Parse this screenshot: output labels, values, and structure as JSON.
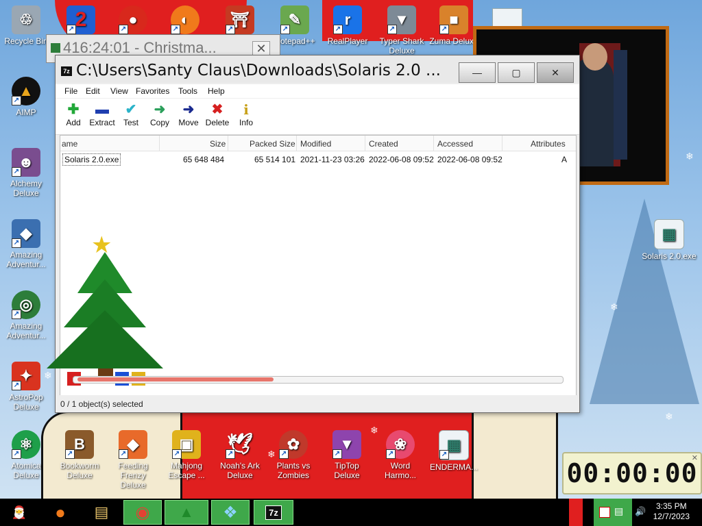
{
  "desktop": {
    "icons_left": [
      {
        "label": "Recycle Bin",
        "icon": "recycle-bin-icon",
        "color": "#9aa7b3"
      },
      {
        "label": "AIMP",
        "icon": "aimp-icon",
        "color": "#e9a51c"
      },
      {
        "label": "Alchemy Deluxe",
        "icon": "alchemy-wizard-icon",
        "color": "#7a4d8f"
      },
      {
        "label": "Amazing Adventur...",
        "icon": "amazing-adventures-icon",
        "color": "#3b6fb0"
      },
      {
        "label": "Amazing Adventur...",
        "icon": "amazing-adventures-globe-icon",
        "color": "#2d7d3a"
      },
      {
        "label": "AstroPop Deluxe",
        "icon": "astropop-icon",
        "color": "#d9331f"
      }
    ],
    "icons_top": [
      {
        "label": "",
        "icon": "number-2-icon",
        "color": "#1f5fd1"
      },
      {
        "label": "",
        "icon": "red-creature-icon",
        "color": "#d8281c"
      },
      {
        "label": "",
        "icon": "firefox-icon",
        "color": "#f07a1b"
      },
      {
        "label": "",
        "icon": "torii-gate-icon",
        "color": "#c53a22"
      },
      {
        "label": "Notepad++",
        "icon": "notepad-plus-plus-icon",
        "color": "#6aa84f"
      },
      {
        "label": "RealPlayer",
        "icon": "realplayer-icon",
        "color": "#1a73e8"
      },
      {
        "label": "Typer Shark Deluxe",
        "icon": "typer-shark-icon",
        "color": "#7d8a96"
      },
      {
        "label": "Zuma Deluxe",
        "icon": "zuma-icon",
        "color": "#d9822b"
      }
    ],
    "icons_bottom": [
      {
        "label": "Atomica Deluxe",
        "icon": "atomica-icon",
        "color": "#1e9f4a"
      },
      {
        "label": "Bookworm Deluxe",
        "icon": "bookworm-icon",
        "color": "#8a5a2b"
      },
      {
        "label": "Feeding Frenzy Deluxe",
        "icon": "feeding-frenzy-icon",
        "color": "#e86a2a"
      },
      {
        "label": "Mahjong Escape ...",
        "icon": "mahjong-icon",
        "color": "#e0b21c"
      },
      {
        "label": "Noah's Ark Deluxe",
        "icon": "dove-icon",
        "color": "#f4f4f4"
      },
      {
        "label": "Plants vs Zombies",
        "icon": "plants-vs-zombies-icon",
        "color": "#c0392b"
      },
      {
        "label": "TipTop Deluxe",
        "icon": "tiptop-icon",
        "color": "#8e44ad"
      },
      {
        "label": "Word Harmo...",
        "icon": "word-harmony-flower-icon",
        "color": "#e84a6f"
      },
      {
        "label": "ENDERMA...",
        "icon": "enderman-file-icon",
        "color": "#d6e3ea"
      }
    ],
    "solaris_icon_label": "Solaris 2.0.exe"
  },
  "background_window": {
    "title": "416:24:01 - Christma...",
    "close_glyph": "✕"
  },
  "main_window": {
    "app_icon_text": "7z",
    "title": "C:\\Users\\Santy Claus\\Downloads\\Solaris 2.0 ...",
    "min_glyph": "—",
    "max_glyph": "▢",
    "close_glyph": "✕",
    "menu": [
      "File",
      "Edit",
      "View",
      "Favorites",
      "Tools",
      "Help"
    ],
    "toolbar": [
      {
        "label": "Add",
        "icon": "plus-icon",
        "glyph": "✚",
        "color": "#22a839"
      },
      {
        "label": "Extract",
        "icon": "minus-icon",
        "glyph": "▬",
        "color": "#1f3fb0"
      },
      {
        "label": "Test",
        "icon": "check-icon",
        "glyph": "✔",
        "color": "#2bb3c9"
      },
      {
        "label": "Copy",
        "icon": "arrow-right-copy-icon",
        "glyph": "➜",
        "color": "#2a9f5a"
      },
      {
        "label": "Move",
        "icon": "arrow-right-move-icon",
        "glyph": "➜",
        "color": "#1a2a8f"
      },
      {
        "label": "Delete",
        "icon": "x-delete-icon",
        "glyph": "✖",
        "color": "#d62020"
      },
      {
        "label": "Info",
        "icon": "info-icon",
        "glyph": "i",
        "color": "#c7a017"
      }
    ],
    "columns": [
      "ame",
      "Size",
      "Packed Size",
      "Modified",
      "Created",
      "Accessed",
      "Attributes"
    ],
    "rows": [
      {
        "name": "Solaris 2.0.exe",
        "size": "65 648 484",
        "packed": "65 514 101",
        "modified": "2021-11-23 03:26",
        "created": "2022-06-08 09:52",
        "accessed": "2022-06-08 09:52",
        "attributes": "A"
      }
    ],
    "status": "0 / 1 object(s) selected"
  },
  "timer": {
    "display": "00:00:00"
  },
  "taskbar": {
    "buttons": [
      {
        "icon": "santa-start-icon",
        "glyph": "🎅"
      },
      {
        "icon": "firefox-icon",
        "glyph": "●"
      },
      {
        "icon": "file-explorer-icon",
        "glyph": "▤"
      },
      {
        "icon": "chrome-icon",
        "glyph": "◉"
      },
      {
        "icon": "christmas-tree-icon",
        "glyph": "▲"
      },
      {
        "icon": "windows-orb-icon",
        "glyph": "❖"
      },
      {
        "icon": "seven-zip-icon",
        "glyph": "7z"
      }
    ],
    "time": "3:35 PM",
    "date": "12/7/2023"
  }
}
